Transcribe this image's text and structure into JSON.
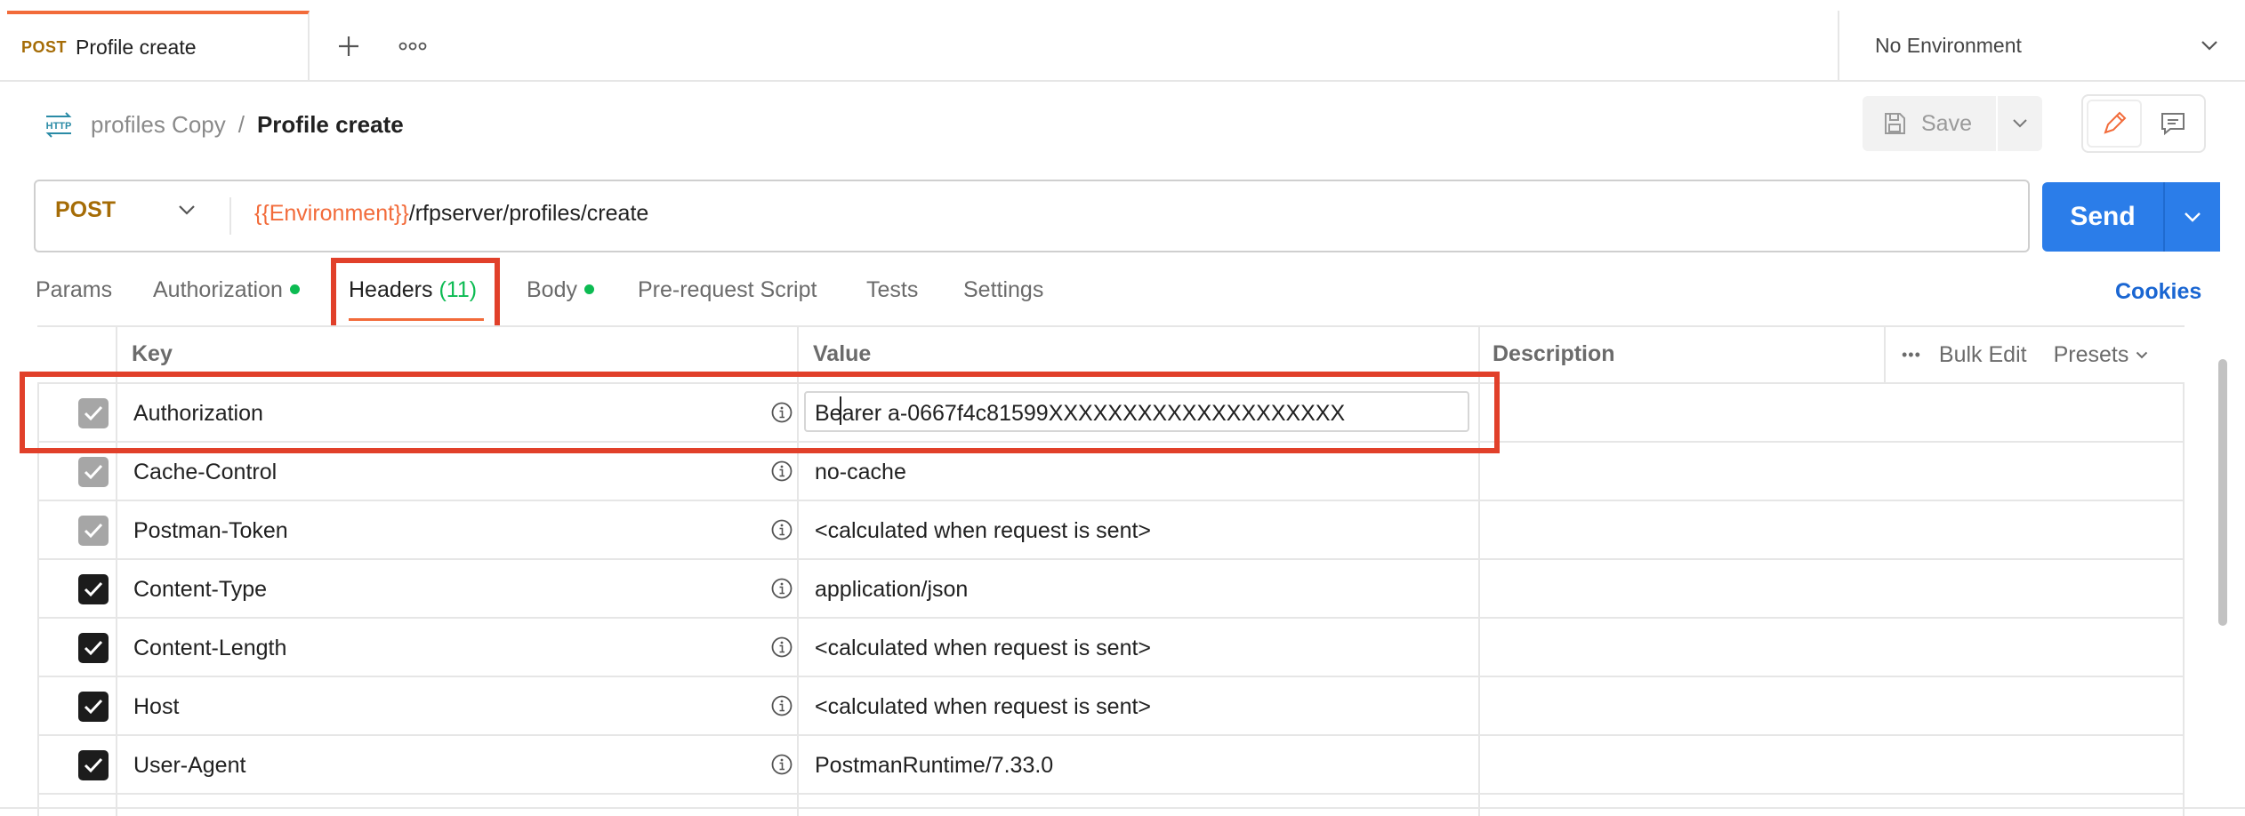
{
  "request_tab": {
    "method": "POST",
    "name": "Profile create",
    "new_tab_icon": "plus-icon",
    "more_icon": "more-horizontal-icon"
  },
  "environment": {
    "label": "No Environment",
    "icon": "chevron-down-icon"
  },
  "breadcrumb": {
    "icon_label": "HTTP",
    "collection": "profiles Copy",
    "separator": "/",
    "request": "Profile create"
  },
  "toolbar": {
    "save_label": "Save",
    "save_icon": "save-icon",
    "edit_icon": "pencil-icon",
    "comment_icon": "comment-icon"
  },
  "url_bar": {
    "method": "POST",
    "url_variable": "{{Environment}}",
    "url_path": "/rfpserver/profiles/create",
    "send_label": "Send"
  },
  "tabs": {
    "params": "Params",
    "authorization": "Authorization",
    "headers": "Headers",
    "headers_count": "(11)",
    "body": "Body",
    "prerequest": "Pre-request Script",
    "tests": "Tests",
    "settings": "Settings",
    "cookies": "Cookies"
  },
  "table": {
    "columns": {
      "key": "Key",
      "value": "Value",
      "description": "Description"
    },
    "actions": {
      "more": "•••",
      "bulk_edit": "Bulk Edit",
      "presets": "Presets"
    },
    "rows": [
      {
        "key": "Authorization",
        "value": "Bearer a-0667f4c81599XXXXXXXXXXXXXXXXXXXX",
        "checked": true,
        "style": "gray",
        "editing": true
      },
      {
        "key": "Cache-Control",
        "value": "no-cache",
        "checked": true,
        "style": "gray"
      },
      {
        "key": "Postman-Token",
        "value": "<calculated when request is sent>",
        "checked": true,
        "style": "gray"
      },
      {
        "key": "Content-Type",
        "value": "application/json",
        "checked": true,
        "style": "dark"
      },
      {
        "key": "Content-Length",
        "value": "<calculated when request is sent>",
        "checked": true,
        "style": "dark"
      },
      {
        "key": "Host",
        "value": "<calculated when request is sent>",
        "checked": true,
        "style": "dark"
      },
      {
        "key": "User-Agent",
        "value": "PostmanRuntime/7.33.0",
        "checked": true,
        "style": "dark"
      }
    ]
  },
  "colors": {
    "accent": "#f26b3a",
    "send_blue": "#2b7de9",
    "highlight_red": "#e1402a",
    "method_post": "#a56c06",
    "active_dot": "#0cbb52"
  }
}
